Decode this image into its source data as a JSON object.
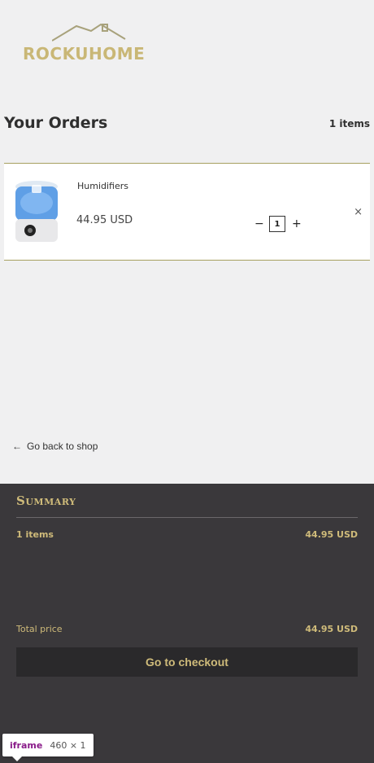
{
  "brand": {
    "name": "ROCKUHOME"
  },
  "orders": {
    "title": "Your Orders",
    "count_label": "1 items",
    "items": [
      {
        "name": "Humidifiers",
        "price": "44.95 USD",
        "quantity": "1",
        "minus": "−",
        "plus": "+",
        "remove": "×"
      }
    ]
  },
  "back_link": {
    "arrow": "←",
    "label": "Go back to shop"
  },
  "summary": {
    "title": "Summary",
    "items_label": "1 items",
    "items_price": "44.95 USD",
    "total_label": "Total price",
    "total_price": "44.95 USD",
    "checkout_label": "Go to checkout"
  },
  "devtools_badge": {
    "tag": "iframe",
    "dims": "460 × 1"
  },
  "colors": {
    "accent": "#cfbb7a",
    "summary_bg": "#3a383b",
    "card_border": "#a7a060"
  }
}
